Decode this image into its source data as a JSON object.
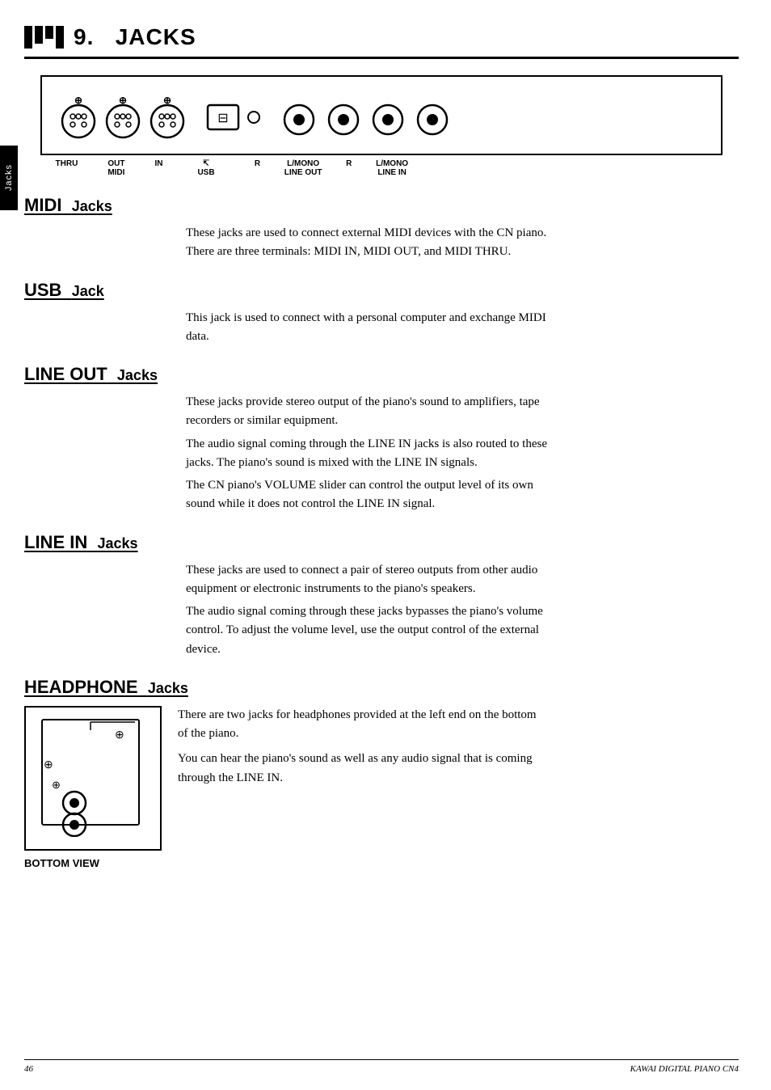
{
  "page": {
    "title": "9. Jacks",
    "title_number": "9.",
    "title_word": "Jacks",
    "side_tab": "Jacks",
    "footer_left": "46",
    "footer_right": "KAWAI DIGITAL PIANO CN4"
  },
  "sections": {
    "midi": {
      "heading": "MIDI Jacks",
      "heading_main": "MIDI",
      "heading_small": "Jacks",
      "text1": "These jacks are used to connect external MIDI devices with the CN piano.",
      "text2": "There are three terminals: MIDI IN, MIDI OUT, and MIDI THRU."
    },
    "usb": {
      "heading": "USB Jack",
      "heading_main": "USB",
      "heading_small": "Jack",
      "text1": "This jack is used to connect with a personal computer and exchange MIDI",
      "text2": "data."
    },
    "line_out": {
      "heading": "LINE OUT Jacks",
      "heading_main": "LINE OUT",
      "heading_small": "Jacks",
      "text1": "These jacks provide stereo output of the piano's sound to amplifiers, tape",
      "text2": "recorders or similar equipment.",
      "text3": "The audio signal coming through the LINE IN jacks is also routed to these",
      "text4": "jacks.  The piano's sound is mixed with the LINE IN signals.",
      "text5": "The CN piano's VOLUME slider can control the output level of its own",
      "text6": "sound while it does not control the LINE IN signal."
    },
    "line_in": {
      "heading": "LINE IN Jacks",
      "heading_main": "LINE IN",
      "heading_small": "Jacks",
      "text1": "These jacks are used to connect a pair of stereo outputs from other audio",
      "text2": "equipment or electronic instruments to the piano's speakers.",
      "text3": "The audio signal coming through these jacks bypasses the piano's volume",
      "text4": "control.  To adjust the volume level, use the output control of the external",
      "text5": "device."
    },
    "headphone": {
      "heading": "HEADPHONE Jacks",
      "heading_main": "HEADPHONE",
      "heading_small": "Jacks",
      "text1": "There are two jacks for headphones provided at the left end on the bottom",
      "text2": "of the piano.",
      "text3": "You can hear the piano's sound as well as any audio signal that is coming",
      "text4": "through the LINE IN.",
      "bottom_view_label": "BOTTOM VIEW"
    }
  },
  "diagram_labels": {
    "thru": "THRU",
    "out": "OUT",
    "in": "IN",
    "midi": "MIDI",
    "usb": "USB",
    "r1": "R",
    "lmono1": "L/MONO",
    "line_out": "LINE OUT",
    "r2": "R",
    "lmono2": "L/MONO",
    "line_in": "LINE IN"
  }
}
